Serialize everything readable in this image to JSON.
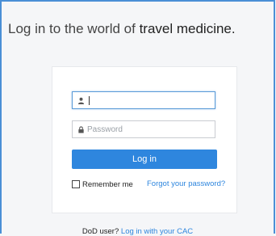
{
  "header": {
    "title_prefix": "Log in to the world of",
    "title_emphasis": "travel medicine."
  },
  "form": {
    "username": {
      "value": "",
      "placeholder": ""
    },
    "password": {
      "value": "",
      "placeholder": "Password"
    },
    "login_label": "Log in",
    "remember_label": "Remember me",
    "remember_checked": false,
    "forgot_label": "Forgot your password?"
  },
  "footer": {
    "dod_text": "DoD user?",
    "cac_link": "Log in with your CAC"
  },
  "colors": {
    "accent": "#2e86de",
    "frame": "#4a8fd6",
    "background": "#f5f6f8"
  },
  "icons": {
    "username": "user-icon",
    "password": "lock-icon"
  }
}
